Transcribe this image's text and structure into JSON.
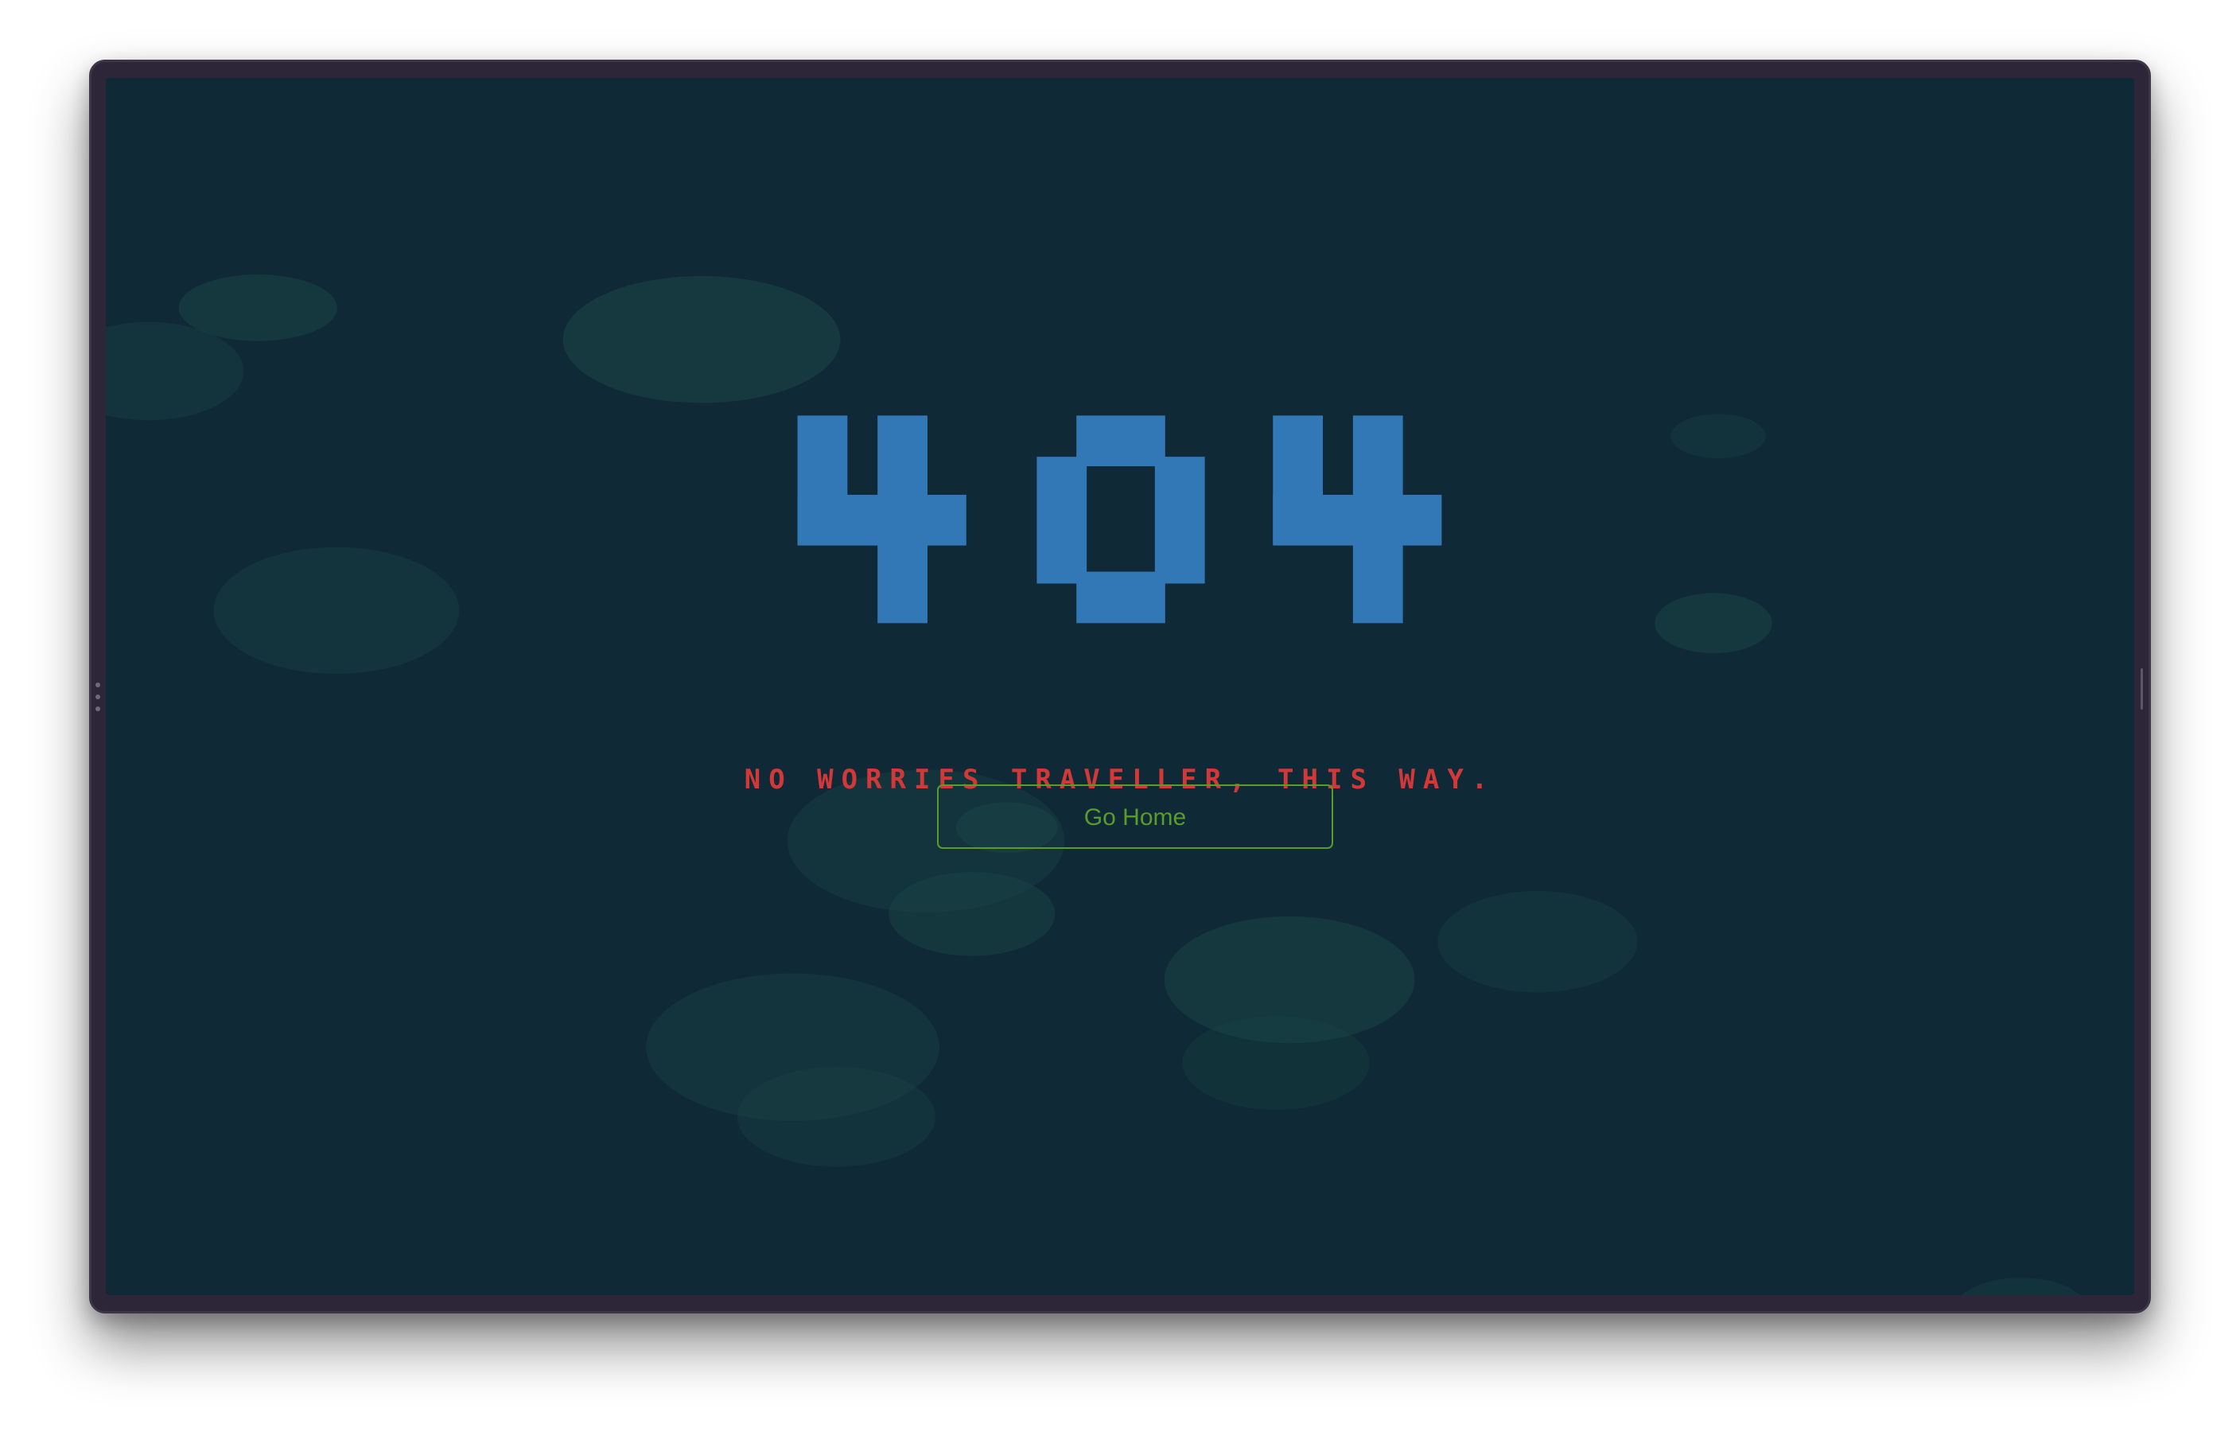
{
  "error_page": {
    "code_digits": [
      "4",
      "0",
      "4"
    ],
    "message": "NO WORRIES TRAVELLER, THIS WAY.",
    "home_button_label": "Go Home"
  },
  "colors": {
    "page_background": "#0f2a36",
    "digit_color": "#3278b6",
    "message_color": "#d23838",
    "button_color": "#5a9c2a",
    "bubble_color": "#1a4446",
    "frame_color": "#2d2638"
  },
  "icons": {
    "left_edge": "handle-dots-icon",
    "right_edge": "handle-slit-icon"
  }
}
